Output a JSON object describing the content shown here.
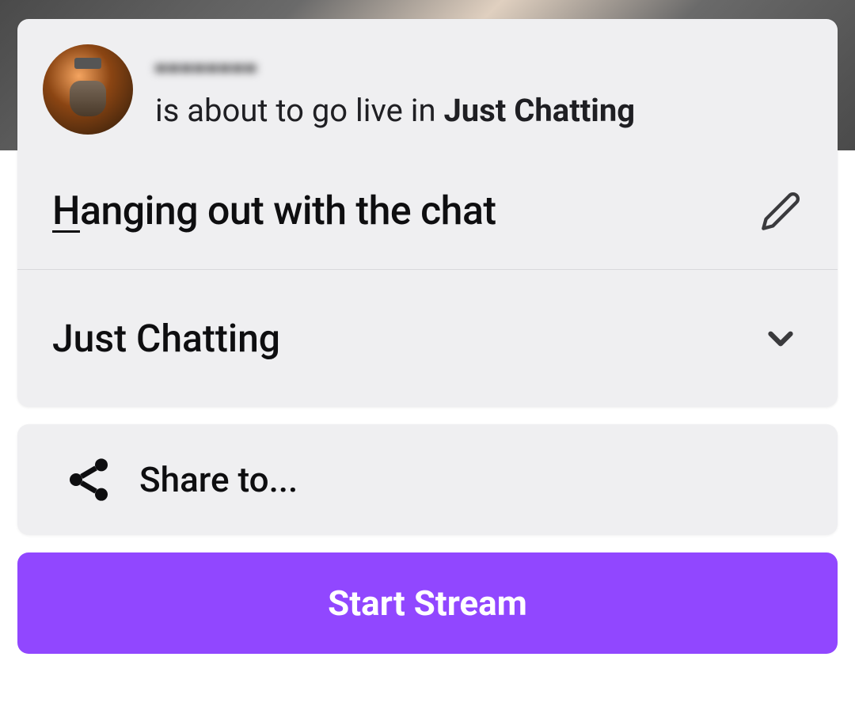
{
  "header": {
    "username": "▪▪▪▪▪▪▪▪",
    "subtitle_prefix": "is about to go live in ",
    "subtitle_category": "Just Chatting"
  },
  "stream": {
    "title_first_char": "H",
    "title_rest": "anging out with the chat",
    "category": "Just Chatting"
  },
  "share": {
    "label": "Share to..."
  },
  "actions": {
    "start_stream": "Start Stream"
  },
  "icons": {
    "edit": "pencil-icon",
    "dropdown": "chevron-down-icon",
    "share": "share-icon"
  },
  "colors": {
    "accent": "#9147ff",
    "card_bg": "#efeff1"
  }
}
